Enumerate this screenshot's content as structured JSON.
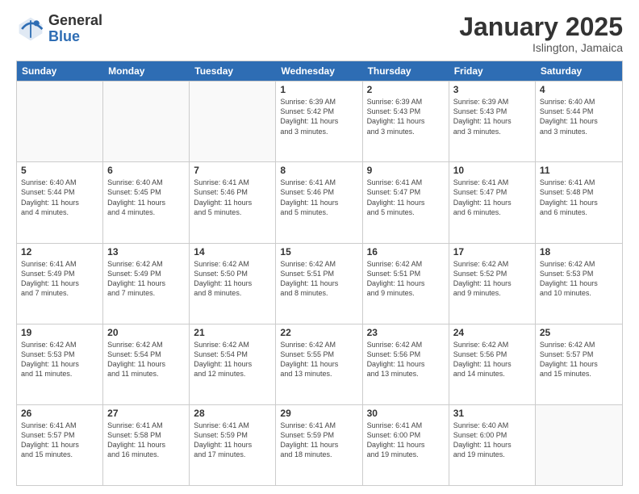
{
  "logo": {
    "general": "General",
    "blue": "Blue"
  },
  "header": {
    "month": "January 2025",
    "location": "Islington, Jamaica"
  },
  "days": [
    "Sunday",
    "Monday",
    "Tuesday",
    "Wednesday",
    "Thursday",
    "Friday",
    "Saturday"
  ],
  "rows": [
    [
      {
        "day": "",
        "info": ""
      },
      {
        "day": "",
        "info": ""
      },
      {
        "day": "",
        "info": ""
      },
      {
        "day": "1",
        "info": "Sunrise: 6:39 AM\nSunset: 5:42 PM\nDaylight: 11 hours\nand 3 minutes."
      },
      {
        "day": "2",
        "info": "Sunrise: 6:39 AM\nSunset: 5:43 PM\nDaylight: 11 hours\nand 3 minutes."
      },
      {
        "day": "3",
        "info": "Sunrise: 6:39 AM\nSunset: 5:43 PM\nDaylight: 11 hours\nand 3 minutes."
      },
      {
        "day": "4",
        "info": "Sunrise: 6:40 AM\nSunset: 5:44 PM\nDaylight: 11 hours\nand 3 minutes."
      }
    ],
    [
      {
        "day": "5",
        "info": "Sunrise: 6:40 AM\nSunset: 5:44 PM\nDaylight: 11 hours\nand 4 minutes."
      },
      {
        "day": "6",
        "info": "Sunrise: 6:40 AM\nSunset: 5:45 PM\nDaylight: 11 hours\nand 4 minutes."
      },
      {
        "day": "7",
        "info": "Sunrise: 6:41 AM\nSunset: 5:46 PM\nDaylight: 11 hours\nand 5 minutes."
      },
      {
        "day": "8",
        "info": "Sunrise: 6:41 AM\nSunset: 5:46 PM\nDaylight: 11 hours\nand 5 minutes."
      },
      {
        "day": "9",
        "info": "Sunrise: 6:41 AM\nSunset: 5:47 PM\nDaylight: 11 hours\nand 5 minutes."
      },
      {
        "day": "10",
        "info": "Sunrise: 6:41 AM\nSunset: 5:47 PM\nDaylight: 11 hours\nand 6 minutes."
      },
      {
        "day": "11",
        "info": "Sunrise: 6:41 AM\nSunset: 5:48 PM\nDaylight: 11 hours\nand 6 minutes."
      }
    ],
    [
      {
        "day": "12",
        "info": "Sunrise: 6:41 AM\nSunset: 5:49 PM\nDaylight: 11 hours\nand 7 minutes."
      },
      {
        "day": "13",
        "info": "Sunrise: 6:42 AM\nSunset: 5:49 PM\nDaylight: 11 hours\nand 7 minutes."
      },
      {
        "day": "14",
        "info": "Sunrise: 6:42 AM\nSunset: 5:50 PM\nDaylight: 11 hours\nand 8 minutes."
      },
      {
        "day": "15",
        "info": "Sunrise: 6:42 AM\nSunset: 5:51 PM\nDaylight: 11 hours\nand 8 minutes."
      },
      {
        "day": "16",
        "info": "Sunrise: 6:42 AM\nSunset: 5:51 PM\nDaylight: 11 hours\nand 9 minutes."
      },
      {
        "day": "17",
        "info": "Sunrise: 6:42 AM\nSunset: 5:52 PM\nDaylight: 11 hours\nand 9 minutes."
      },
      {
        "day": "18",
        "info": "Sunrise: 6:42 AM\nSunset: 5:53 PM\nDaylight: 11 hours\nand 10 minutes."
      }
    ],
    [
      {
        "day": "19",
        "info": "Sunrise: 6:42 AM\nSunset: 5:53 PM\nDaylight: 11 hours\nand 11 minutes."
      },
      {
        "day": "20",
        "info": "Sunrise: 6:42 AM\nSunset: 5:54 PM\nDaylight: 11 hours\nand 11 minutes."
      },
      {
        "day": "21",
        "info": "Sunrise: 6:42 AM\nSunset: 5:54 PM\nDaylight: 11 hours\nand 12 minutes."
      },
      {
        "day": "22",
        "info": "Sunrise: 6:42 AM\nSunset: 5:55 PM\nDaylight: 11 hours\nand 13 minutes."
      },
      {
        "day": "23",
        "info": "Sunrise: 6:42 AM\nSunset: 5:56 PM\nDaylight: 11 hours\nand 13 minutes."
      },
      {
        "day": "24",
        "info": "Sunrise: 6:42 AM\nSunset: 5:56 PM\nDaylight: 11 hours\nand 14 minutes."
      },
      {
        "day": "25",
        "info": "Sunrise: 6:42 AM\nSunset: 5:57 PM\nDaylight: 11 hours\nand 15 minutes."
      }
    ],
    [
      {
        "day": "26",
        "info": "Sunrise: 6:41 AM\nSunset: 5:57 PM\nDaylight: 11 hours\nand 15 minutes."
      },
      {
        "day": "27",
        "info": "Sunrise: 6:41 AM\nSunset: 5:58 PM\nDaylight: 11 hours\nand 16 minutes."
      },
      {
        "day": "28",
        "info": "Sunrise: 6:41 AM\nSunset: 5:59 PM\nDaylight: 11 hours\nand 17 minutes."
      },
      {
        "day": "29",
        "info": "Sunrise: 6:41 AM\nSunset: 5:59 PM\nDaylight: 11 hours\nand 18 minutes."
      },
      {
        "day": "30",
        "info": "Sunrise: 6:41 AM\nSunset: 6:00 PM\nDaylight: 11 hours\nand 19 minutes."
      },
      {
        "day": "31",
        "info": "Sunrise: 6:40 AM\nSunset: 6:00 PM\nDaylight: 11 hours\nand 19 minutes."
      },
      {
        "day": "",
        "info": ""
      }
    ]
  ]
}
